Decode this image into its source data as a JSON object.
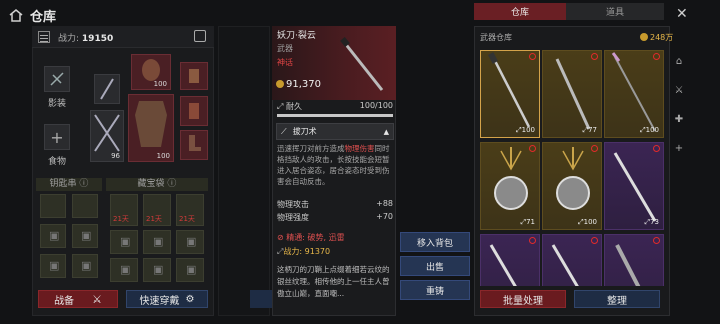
{
  "header": {
    "title": "仓库"
  },
  "left": {
    "power_label": "战力:",
    "power_value": "19150",
    "slot_labels": {
      "appearance": "影装",
      "food": "食物"
    },
    "equip_counts": {
      "helmet": "100",
      "weapon": "96",
      "armor": "100"
    },
    "sections": {
      "skewer": "钥匙串",
      "treasure": "藏宝袋"
    },
    "timers": [
      "21天",
      "21天",
      "21天"
    ],
    "buttons": {
      "battle": "战备",
      "quick_equip": "快速穿戴"
    }
  },
  "detail": {
    "name": "妖刀·裂云",
    "type": "武器",
    "rarity": "神话",
    "price": "91,370",
    "durability_label": "耐久",
    "durability_value": "100/100",
    "durability_fraction": 1.0,
    "skill_name": "拔刀术",
    "skill_desc_1": "迅速挥刀对前方造成",
    "skill_desc_hl": "物理伤害",
    "skill_desc_2": "同时格挡敌人的攻击，长按技能会短暂进入居合姿态，居合姿态时受到伤害会自动反击。",
    "stats": [
      {
        "label": "物理攻击",
        "value": "+88"
      },
      {
        "label": "物理强度",
        "value": "+70"
      }
    ],
    "refine": "精通: 破势, 迅雷",
    "combat_label": "战力:",
    "combat_value": "91370",
    "lore": "这柄刀的刀鞘上点缀着细若云纹的银丝纹理。相传他的上一任主人曾傲立山巅，直面嘲..."
  },
  "actions": [
    "移入背包",
    "出售",
    "重铸"
  ],
  "warehouse": {
    "tabs": [
      "仓库",
      "道具"
    ],
    "title": "武器仓库",
    "gold": "248万",
    "cells": [
      {
        "count": "100",
        "rarity": "gold",
        "selected": true,
        "icon": "katana-icon"
      },
      {
        "count": "77",
        "rarity": "gold",
        "icon": "greatsword-icon"
      },
      {
        "count": "100",
        "rarity": "gold",
        "icon": "spear-icon"
      },
      {
        "count": "71",
        "rarity": "gold",
        "icon": "censer-icon"
      },
      {
        "count": "100",
        "rarity": "gold",
        "icon": "censer-icon"
      },
      {
        "count": "73",
        "rarity": "purple",
        "icon": "sword-icon"
      },
      {
        "count": "",
        "rarity": "purple",
        "icon": "sword-icon"
      },
      {
        "count": "",
        "rarity": "purple",
        "icon": "sword-icon"
      },
      {
        "count": "",
        "rarity": "purple",
        "icon": "glaive-icon"
      }
    ],
    "buttons": {
      "batch": "批量处理",
      "sort": "整理"
    }
  },
  "colors": {
    "accent_red": "#6a1b1f",
    "rarity_red": "#e24545",
    "gold": "#e8b84a",
    "action_blue": "#253553"
  }
}
